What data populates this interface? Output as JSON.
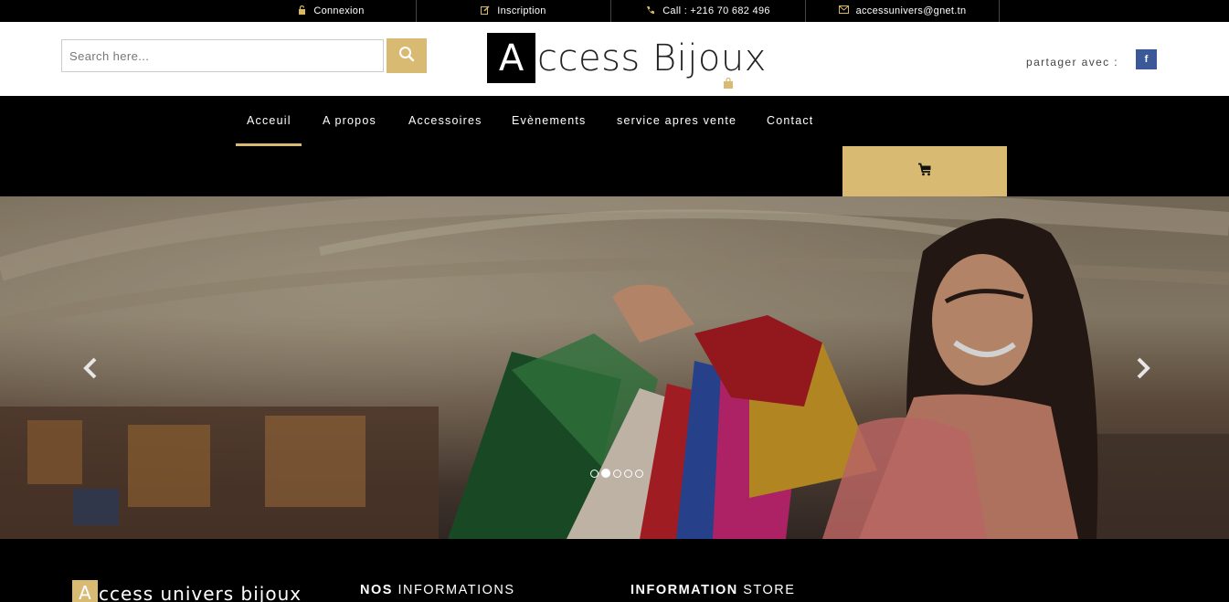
{
  "topbar": {
    "login": "Connexion",
    "register": "Inscription",
    "phone": "Call : +216 70 682 496",
    "email": "accessunivers@gnet.tn"
  },
  "header": {
    "search_placeholder": "Search here...",
    "logo_first": "A",
    "logo_rest": "ccess Bijoux",
    "share_label": "partager avec :",
    "facebook_letter": "f"
  },
  "nav": {
    "items": [
      {
        "label": "Acceuil"
      },
      {
        "label": "A propos"
      },
      {
        "label": "Accessoires"
      },
      {
        "label": "Evènements"
      },
      {
        "label": "service apres vente"
      },
      {
        "label": "Contact"
      }
    ]
  },
  "carousel": {
    "slide_count": 5,
    "active_slide": 2
  },
  "footer": {
    "logo_first": "A",
    "logo_rest": "ccess univers bijoux",
    "info_bold": "NOS",
    "info_rest": " INFORMATIONS",
    "store_bold": "INFORMATION",
    "store_rest": " STORE"
  },
  "colors": {
    "accent": "#d8ba72",
    "facebook": "#3b5998"
  }
}
